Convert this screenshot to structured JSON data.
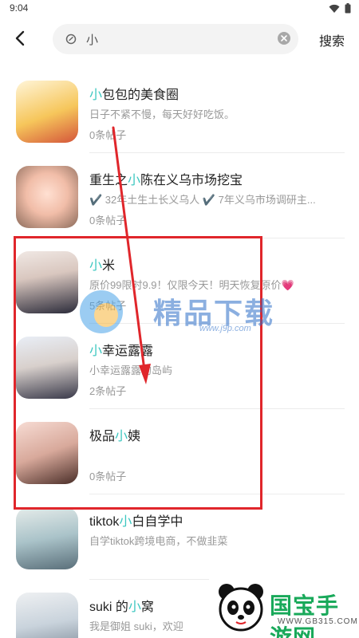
{
  "status_bar": {
    "time": "9:04"
  },
  "search": {
    "query": "小",
    "action_label": "搜索"
  },
  "results": [
    {
      "title_highlight": "小",
      "title_rest": "包包的美食圈",
      "title_prefix": "",
      "description": "日子不紧不慢，每天好好吃饭。",
      "posts": "0条帖子"
    },
    {
      "title_prefix": "重生之",
      "title_highlight": "小",
      "title_rest": "陈在义乌市场挖宝",
      "description": "✔️ 32年土生土长义乌人 ✔️ 7年义乌市场调研主...",
      "posts": "0条帖子"
    },
    {
      "title_prefix": "",
      "title_highlight": "小",
      "title_rest": "米",
      "description": "原价99限时9.9！仅限今天！明天恢复原价💗",
      "posts": "5条帖子"
    },
    {
      "title_prefix": "",
      "title_highlight": "小",
      "title_rest": "幸运露露",
      "description": "小幸运露露的岛屿",
      "posts": "2条帖子"
    },
    {
      "title_prefix": "极品",
      "title_highlight": "小",
      "title_rest": "姨",
      "description": "",
      "posts": "0条帖子"
    },
    {
      "title_prefix": "tiktok",
      "title_highlight": "小",
      "title_rest": "白自学中",
      "description": "自学tiktok跨境电商，不做韭菜",
      "posts": ""
    },
    {
      "title_prefix": "suki 的",
      "title_highlight": "小",
      "title_rest": "窝",
      "description": "我是御姐 suki，欢迎",
      "posts": ""
    }
  ],
  "watermark": {
    "title": "精品下载",
    "url": "www.j9p.com"
  },
  "logo_badge": {
    "name": "国宝手游网",
    "url": "WWW.GB315.COM"
  },
  "colors": {
    "highlight": "#3cc7c0",
    "annotation_red": "#e0262b"
  }
}
